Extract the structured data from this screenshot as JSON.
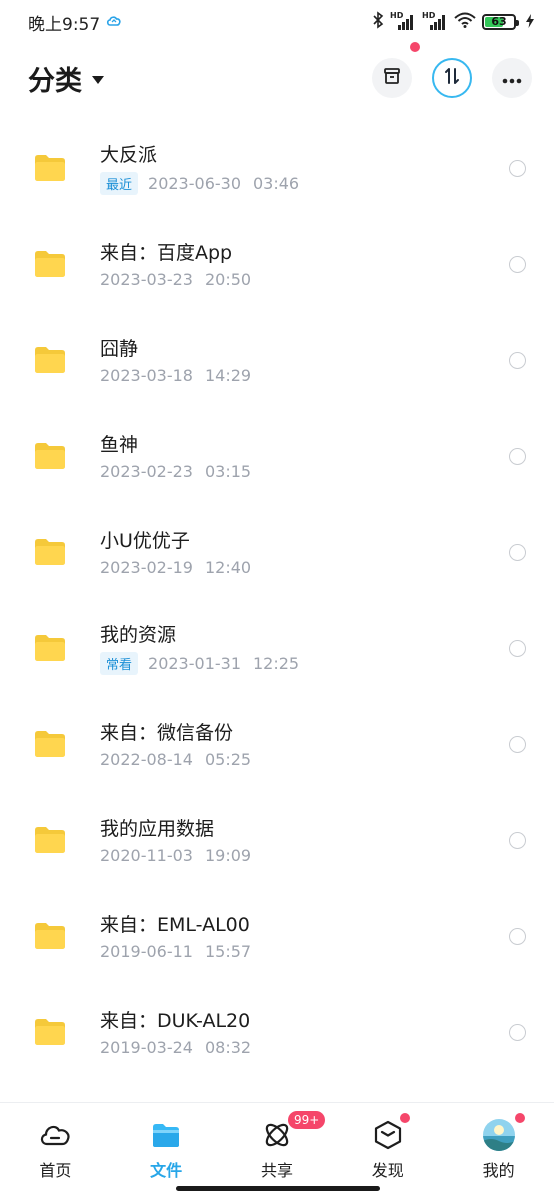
{
  "status_bar": {
    "time": "晚上9:57",
    "network_label_1": "HD",
    "network_label_2": "HD",
    "battery_level": "63"
  },
  "header": {
    "title": "分类"
  },
  "files": [
    {
      "name": "大反派",
      "tag": "最近",
      "date": "2023-06-30",
      "time": "03:46"
    },
    {
      "name": "来自：百度App",
      "tag": "",
      "date": "2023-03-23",
      "time": "20:50"
    },
    {
      "name": "囧静",
      "tag": "",
      "date": "2023-03-18",
      "time": "14:29"
    },
    {
      "name": "鱼神",
      "tag": "",
      "date": "2023-02-23",
      "time": "03:15"
    },
    {
      "name": "小U优优子",
      "tag": "",
      "date": "2023-02-19",
      "time": "12:40"
    },
    {
      "name": "我的资源",
      "tag": "常看",
      "date": "2023-01-31",
      "time": "12:25"
    },
    {
      "name": "来自：微信备份",
      "tag": "",
      "date": "2022-08-14",
      "time": "05:25"
    },
    {
      "name": "我的应用数据",
      "tag": "",
      "date": "2020-11-03",
      "time": "19:09"
    },
    {
      "name": "来自：EML-AL00",
      "tag": "",
      "date": "2019-06-11",
      "time": "15:57"
    },
    {
      "name": "来自：DUK-AL20",
      "tag": "",
      "date": "2019-03-24",
      "time": "08:32"
    }
  ],
  "bottom_nav": {
    "items": [
      {
        "label": "首页",
        "icon": "cloud-icon"
      },
      {
        "label": "文件",
        "icon": "folder-icon"
      },
      {
        "label": "共享",
        "icon": "atom-icon",
        "badge": "99+"
      },
      {
        "label": "发现",
        "icon": "cube-icon"
      },
      {
        "label": "我的",
        "icon": "avatar-icon"
      }
    ]
  },
  "colors": {
    "accent": "#27a6e8",
    "folder": "#ffd64f",
    "badge_red": "#f5466a",
    "meta_gray": "#9ea3ad"
  }
}
